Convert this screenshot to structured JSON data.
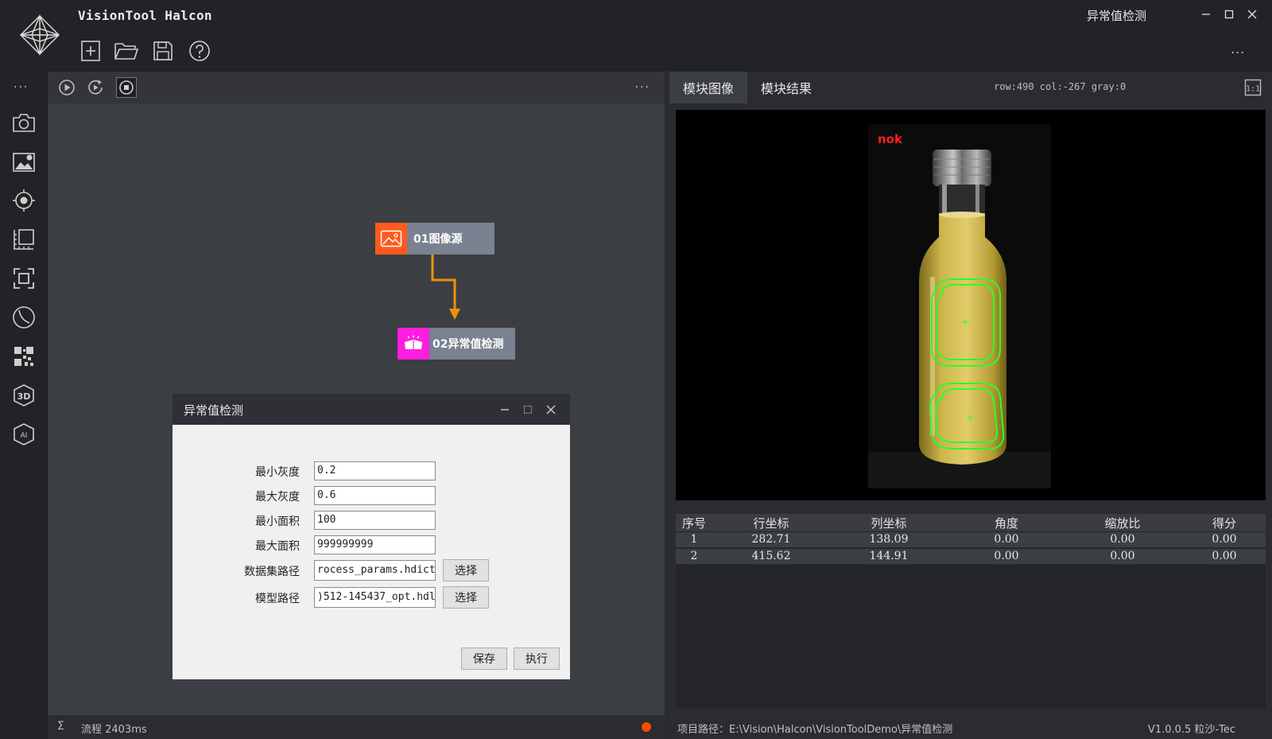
{
  "app": {
    "title": "VisionTool Halcon",
    "window_caption": "异常值检测",
    "more": "..."
  },
  "sidebar": {
    "more": "..."
  },
  "flow": {
    "more": "...",
    "status_text": "流程 2403ms",
    "sigma": "Σ",
    "nodes": [
      {
        "label": "01图像源",
        "icon_color": "#ff5a1f"
      },
      {
        "label": "02异常值检测",
        "icon_color": "#ff1ee0"
      }
    ]
  },
  "dialog": {
    "title": "异常值检测",
    "fields": [
      {
        "label": "最小灰度",
        "value": "0.2"
      },
      {
        "label": "最大灰度",
        "value": "0.6"
      },
      {
        "label": "最小面积",
        "value": "100"
      },
      {
        "label": "最大面积",
        "value": "999999999"
      },
      {
        "label": "数据集路径",
        "value": "rocess_params.hdict"
      },
      {
        "label": "模型路径",
        "value": ")512-145437_opt.hdl"
      }
    ],
    "browse_label": "选择",
    "save_label": "保存",
    "run_label": "执行"
  },
  "image_panel": {
    "tabs": [
      "模块图像",
      "模块结果"
    ],
    "pixel_info": "row:490 col:-267 gray:0",
    "overlay_text": "nok"
  },
  "results": {
    "columns": [
      "序号",
      "行坐标",
      "列坐标",
      "角度",
      "缩放比",
      "得分"
    ],
    "rows": [
      [
        "1",
        "282.71",
        "138.09",
        "0.00",
        "0.00",
        "0.00"
      ],
      [
        "2",
        "415.62",
        "144.91",
        "0.00",
        "0.00",
        "0.00"
      ]
    ]
  },
  "status": {
    "project_path": "项目路径：E:\\Vision\\Halcon\\VisionToolDemo\\异常值检测",
    "version": "V1.0.0.5 粒沙-Tec"
  },
  "colors": {
    "accent_orange": "#ff5a1f",
    "accent_magenta": "#ff1ee0",
    "connector": "#f0900c",
    "status_dot": "#ff4800",
    "detection_green": "#2bff2b",
    "nok_red": "#ff2020"
  }
}
